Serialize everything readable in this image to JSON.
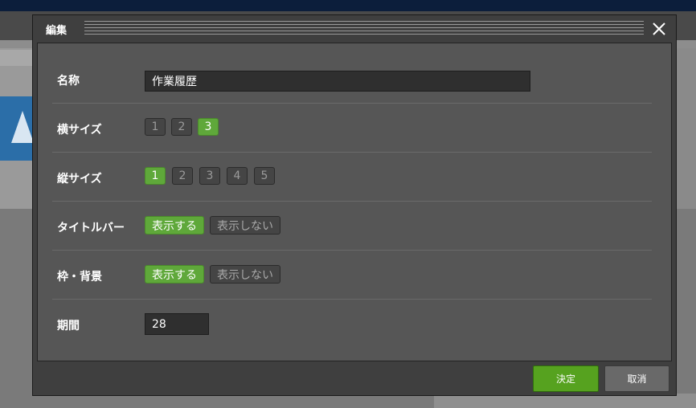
{
  "dialog": {
    "title": "編集",
    "close_icon": "close-icon"
  },
  "form": {
    "name": {
      "label": "名称",
      "value": "作業履歴"
    },
    "width": {
      "label": "横サイズ",
      "options": [
        "1",
        "2",
        "3"
      ],
      "selected": "3"
    },
    "height": {
      "label": "縦サイズ",
      "options": [
        "1",
        "2",
        "3",
        "4",
        "5"
      ],
      "selected": "1"
    },
    "titlebar": {
      "label": "タイトルバー",
      "show": "表示する",
      "hide": "表示しない",
      "selected": "show"
    },
    "frame": {
      "label": "枠・背景",
      "show": "表示する",
      "hide": "表示しない",
      "selected": "show"
    },
    "period": {
      "label": "期間",
      "value": "28"
    }
  },
  "footer": {
    "ok_label": "決定",
    "cancel_label": "取消"
  },
  "colors": {
    "accent": "#5fa83a",
    "ok": "#56a21f",
    "panel": "#565656"
  }
}
